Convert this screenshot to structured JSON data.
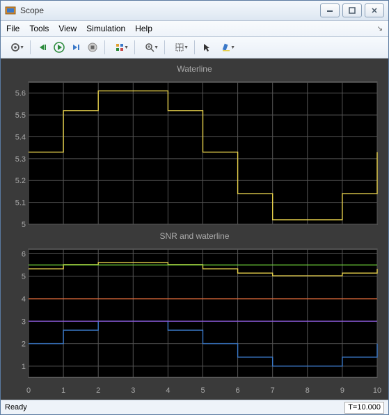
{
  "window": {
    "title": "Scope",
    "status_text": "Ready",
    "time_text": "T=10.000"
  },
  "menu": {
    "items": [
      "File",
      "Tools",
      "View",
      "Simulation",
      "Help"
    ]
  },
  "toolbar": {
    "icons": [
      {
        "name": "configure-icon"
      },
      {
        "name": "step-back-icon"
      },
      {
        "name": "run-icon"
      },
      {
        "name": "step-forward-icon"
      },
      {
        "name": "stop-icon"
      },
      {
        "name": "triggers-icon"
      },
      {
        "name": "zoom-icon"
      },
      {
        "name": "autoscale-icon"
      },
      {
        "name": "cursor-icon"
      },
      {
        "name": "highlight-icon"
      }
    ]
  },
  "chart_data": [
    {
      "type": "line",
      "title": "Waterline",
      "xlim": [
        0,
        10
      ],
      "ylim": [
        5.0,
        5.65
      ],
      "yticks": [
        5,
        5.1,
        5.2,
        5.3,
        5.4,
        5.5,
        5.6
      ],
      "xticks": [
        0,
        1,
        2,
        3,
        4,
        5,
        6,
        7,
        8,
        9,
        10
      ],
      "x": [
        0,
        1,
        2,
        3,
        4,
        5,
        6,
        7,
        8,
        9,
        10
      ],
      "series": [
        {
          "name": "waterline",
          "color": "#e6d04c",
          "values": [
            5.33,
            5.52,
            5.61,
            5.61,
            5.52,
            5.33,
            5.14,
            5.02,
            5.02,
            5.14,
            5.33
          ]
        }
      ]
    },
    {
      "type": "line",
      "title": "SNR and waterline",
      "xlim": [
        0,
        10
      ],
      "ylim": [
        0.5,
        6.2
      ],
      "yticks": [
        1,
        2,
        3,
        4,
        5,
        6
      ],
      "xticks": [
        0,
        1,
        2,
        3,
        4,
        5,
        6,
        7,
        8,
        9,
        10
      ],
      "showXLabels": true,
      "x": [
        0,
        1,
        2,
        3,
        4,
        5,
        6,
        7,
        8,
        9,
        10
      ],
      "series": [
        {
          "name": "waterline",
          "color": "#e6d04c",
          "values": [
            5.33,
            5.52,
            5.61,
            5.61,
            5.52,
            5.33,
            5.14,
            5.02,
            5.02,
            5.14,
            5.33
          ]
        },
        {
          "name": "blue",
          "color": "#3a78c8",
          "values": [
            2.0,
            2.6,
            3.0,
            3.0,
            2.6,
            2.0,
            1.4,
            1.0,
            1.0,
            1.4,
            2.0
          ]
        },
        {
          "name": "red",
          "color": "#e06a3a",
          "values": [
            4,
            4,
            4,
            4,
            4,
            4,
            4,
            4,
            4,
            4,
            4
          ]
        },
        {
          "name": "purple",
          "color": "#8a5ad8",
          "values": [
            3,
            3,
            3,
            3,
            3,
            3,
            3,
            3,
            3,
            3,
            3
          ]
        },
        {
          "name": "green",
          "color": "#6ed43a",
          "values": [
            5.5,
            5.5,
            5.5,
            5.5,
            5.5,
            5.5,
            5.5,
            5.5,
            5.5,
            5.5,
            5.5
          ]
        }
      ]
    }
  ]
}
